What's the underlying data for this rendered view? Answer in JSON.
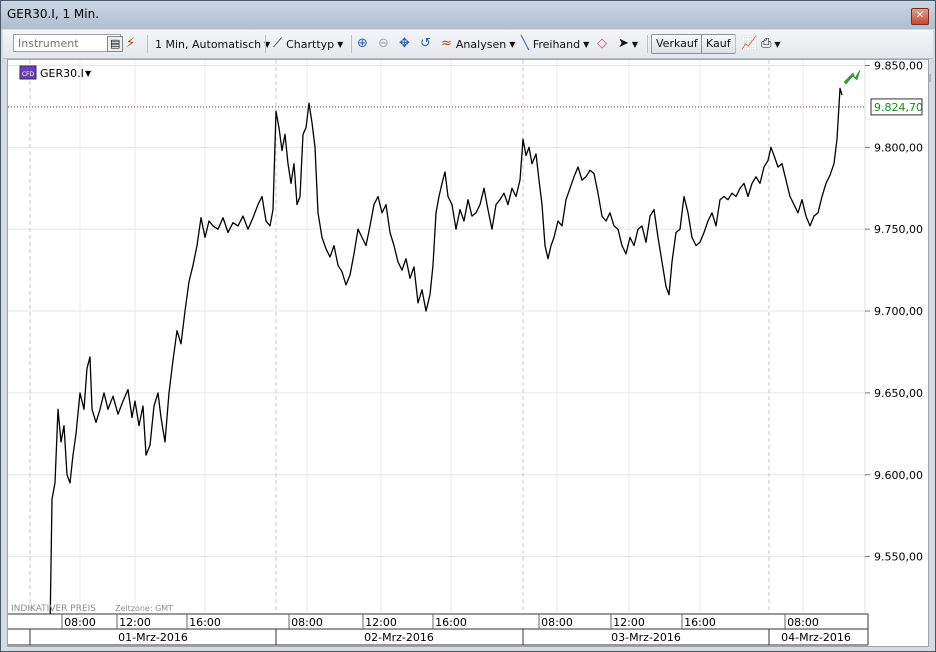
{
  "window": {
    "title": "GER30.I, 1 Min."
  },
  "toolbar": {
    "instrument_placeholder": "Instrument",
    "interval_label": "1 Min,  Automatisch",
    "charttype_label": "Charttyp",
    "analysen_label": "Analysen",
    "freihand_label": "Freihand",
    "verkauf_label": "Verkauf",
    "kauf_label": "Kauf"
  },
  "chart_header": {
    "symbol": "GER30.I",
    "badge": "CFD"
  },
  "footer": {
    "price_type": "INDIKATIVER PREIS",
    "timezone": "Zeitzone: GMT"
  },
  "chart_data": {
    "type": "line",
    "title": "",
    "symbol": "GER30.I",
    "interval": "1 Min.",
    "current_price": 9824.7,
    "current_price_label": "9.824,70",
    "ylim": [
      9505,
      9855
    ],
    "yticks": [
      {
        "value": 9550,
        "label": "9.550,00"
      },
      {
        "value": 9600,
        "label": "9.600,00"
      },
      {
        "value": 9650,
        "label": "9.650,00"
      },
      {
        "value": 9700,
        "label": "9.700,00"
      },
      {
        "value": 9750,
        "label": "9.750,00"
      },
      {
        "value": 9800,
        "label": "9.800,00"
      },
      {
        "value": 9850,
        "label": "9.850,00"
      }
    ],
    "xlim": [
      0,
      834
    ],
    "xticks": [
      {
        "x": 72,
        "label": "08:00"
      },
      {
        "x": 127,
        "label": "12:00"
      },
      {
        "x": 197,
        "label": "16:00"
      },
      {
        "x": 299,
        "label": "08:00"
      },
      {
        "x": 373,
        "label": "12:00"
      },
      {
        "x": 443,
        "label": "16:00"
      },
      {
        "x": 549,
        "label": "08:00"
      },
      {
        "x": 621,
        "label": "12:00"
      },
      {
        "x": 692,
        "label": "16:00"
      },
      {
        "x": 795,
        "label": "08:00"
      }
    ],
    "day_dividers": [
      22,
      268,
      515,
      761
    ],
    "days": [
      {
        "x": 145,
        "label": "01-Mrz-2016"
      },
      {
        "x": 391,
        "label": "02-Mrz-2016"
      },
      {
        "x": 638,
        "label": "03-Mrz-2016"
      },
      {
        "x": 808,
        "label": "04-Mrz-2016"
      }
    ],
    "series": [
      {
        "values": [
          [
            42,
            9505
          ],
          [
            44,
            9585
          ],
          [
            47,
            9595
          ],
          [
            50,
            9640
          ],
          [
            53,
            9620
          ],
          [
            56,
            9630
          ],
          [
            59,
            9600
          ],
          [
            62,
            9595
          ],
          [
            65,
            9612
          ],
          [
            68,
            9625
          ],
          [
            72,
            9650
          ],
          [
            76,
            9640
          ],
          [
            79,
            9665
          ],
          [
            82,
            9672
          ],
          [
            84,
            9640
          ],
          [
            88,
            9632
          ],
          [
            92,
            9640
          ],
          [
            96,
            9650
          ],
          [
            100,
            9640
          ],
          [
            105,
            9648
          ],
          [
            110,
            9637
          ],
          [
            115,
            9645
          ],
          [
            120,
            9652
          ],
          [
            124,
            9635
          ],
          [
            127,
            9645
          ],
          [
            131,
            9630
          ],
          [
            135,
            9642
          ],
          [
            138,
            9612
          ],
          [
            142,
            9618
          ],
          [
            146,
            9642
          ],
          [
            150,
            9650
          ],
          [
            153,
            9635
          ],
          [
            157,
            9620
          ],
          [
            161,
            9650
          ],
          [
            165,
            9670
          ],
          [
            169,
            9688
          ],
          [
            173,
            9680
          ],
          [
            177,
            9700
          ],
          [
            181,
            9718
          ],
          [
            185,
            9728
          ],
          [
            189,
            9740
          ],
          [
            193,
            9757
          ],
          [
            197,
            9745
          ],
          [
            201,
            9755
          ],
          [
            205,
            9752
          ],
          [
            210,
            9750
          ],
          [
            215,
            9757
          ],
          [
            220,
            9748
          ],
          [
            225,
            9754
          ],
          [
            230,
            9752
          ],
          [
            235,
            9758
          ],
          [
            240,
            9750
          ],
          [
            245,
            9757
          ],
          [
            250,
            9765
          ],
          [
            254,
            9770
          ],
          [
            258,
            9755
          ],
          [
            262,
            9752
          ],
          [
            265,
            9762
          ],
          [
            268,
            9822
          ],
          [
            271,
            9812
          ],
          [
            274,
            9798
          ],
          [
            277,
            9808
          ],
          [
            280,
            9790
          ],
          [
            283,
            9778
          ],
          [
            286,
            9790
          ],
          [
            289,
            9765
          ],
          [
            292,
            9770
          ],
          [
            295,
            9808
          ],
          [
            298,
            9812
          ],
          [
            301,
            9827
          ],
          [
            304,
            9815
          ],
          [
            307,
            9800
          ],
          [
            310,
            9760
          ],
          [
            314,
            9745
          ],
          [
            318,
            9738
          ],
          [
            322,
            9733
          ],
          [
            326,
            9740
          ],
          [
            330,
            9728
          ],
          [
            334,
            9724
          ],
          [
            338,
            9716
          ],
          [
            342,
            9722
          ],
          [
            346,
            9735
          ],
          [
            350,
            9750
          ],
          [
            354,
            9745
          ],
          [
            358,
            9740
          ],
          [
            362,
            9752
          ],
          [
            366,
            9765
          ],
          [
            370,
            9770
          ],
          [
            374,
            9760
          ],
          [
            378,
            9765
          ],
          [
            382,
            9748
          ],
          [
            386,
            9740
          ],
          [
            390,
            9730
          ],
          [
            394,
            9725
          ],
          [
            398,
            9732
          ],
          [
            402,
            9720
          ],
          [
            406,
            9727
          ],
          [
            410,
            9705
          ],
          [
            414,
            9713
          ],
          [
            418,
            9700
          ],
          [
            422,
            9710
          ],
          [
            425,
            9728
          ],
          [
            428,
            9760
          ],
          [
            431,
            9770
          ],
          [
            434,
            9778
          ],
          [
            437,
            9785
          ],
          [
            440,
            9770
          ],
          [
            444,
            9765
          ],
          [
            448,
            9750
          ],
          [
            452,
            9762
          ],
          [
            456,
            9755
          ],
          [
            460,
            9768
          ],
          [
            464,
            9758
          ],
          [
            468,
            9760
          ],
          [
            472,
            9765
          ],
          [
            476,
            9775
          ],
          [
            480,
            9762
          ],
          [
            484,
            9750
          ],
          [
            488,
            9765
          ],
          [
            492,
            9768
          ],
          [
            496,
            9772
          ],
          [
            500,
            9765
          ],
          [
            504,
            9775
          ],
          [
            508,
            9770
          ],
          [
            512,
            9780
          ],
          [
            515,
            9805
          ],
          [
            518,
            9795
          ],
          [
            521,
            9800
          ],
          [
            524,
            9790
          ],
          [
            528,
            9796
          ],
          [
            531,
            9780
          ],
          [
            534,
            9765
          ],
          [
            537,
            9740
          ],
          [
            540,
            9732
          ],
          [
            543,
            9740
          ],
          [
            546,
            9745
          ],
          [
            550,
            9755
          ],
          [
            554,
            9752
          ],
          [
            558,
            9768
          ],
          [
            562,
            9775
          ],
          [
            566,
            9782
          ],
          [
            570,
            9788
          ],
          [
            574,
            9780
          ],
          [
            578,
            9782
          ],
          [
            582,
            9786
          ],
          [
            586,
            9784
          ],
          [
            590,
            9772
          ],
          [
            594,
            9758
          ],
          [
            598,
            9755
          ],
          [
            602,
            9760
          ],
          [
            606,
            9752
          ],
          [
            610,
            9750
          ],
          [
            614,
            9740
          ],
          [
            618,
            9735
          ],
          [
            622,
            9745
          ],
          [
            626,
            9740
          ],
          [
            630,
            9750
          ],
          [
            634,
            9752
          ],
          [
            638,
            9742
          ],
          [
            642,
            9758
          ],
          [
            646,
            9762
          ],
          [
            650,
            9745
          ],
          [
            654,
            9730
          ],
          [
            658,
            9715
          ],
          [
            661,
            9710
          ],
          [
            664,
            9730
          ],
          [
            668,
            9748
          ],
          [
            672,
            9750
          ],
          [
            676,
            9770
          ],
          [
            680,
            9760
          ],
          [
            684,
            9745
          ],
          [
            688,
            9740
          ],
          [
            692,
            9742
          ],
          [
            696,
            9748
          ],
          [
            700,
            9755
          ],
          [
            704,
            9760
          ],
          [
            708,
            9752
          ],
          [
            712,
            9768
          ],
          [
            716,
            9770
          ],
          [
            720,
            9768
          ],
          [
            724,
            9772
          ],
          [
            728,
            9770
          ],
          [
            732,
            9775
          ],
          [
            736,
            9778
          ],
          [
            740,
            9770
          ],
          [
            744,
            9778
          ],
          [
            748,
            9782
          ],
          [
            752,
            9778
          ],
          [
            756,
            9788
          ],
          [
            760,
            9792
          ],
          [
            763,
            9800
          ],
          [
            766,
            9795
          ],
          [
            770,
            9788
          ],
          [
            774,
            9790
          ],
          [
            778,
            9780
          ],
          [
            782,
            9770
          ],
          [
            786,
            9765
          ],
          [
            790,
            9760
          ],
          [
            794,
            9768
          ],
          [
            798,
            9758
          ],
          [
            802,
            9752
          ],
          [
            806,
            9758
          ],
          [
            810,
            9760
          ],
          [
            814,
            9770
          ],
          [
            818,
            9778
          ],
          [
            822,
            9783
          ],
          [
            826,
            9790
          ],
          [
            829,
            9805
          ],
          [
            832,
            9836
          ],
          [
            834,
            9832
          ]
        ]
      }
    ]
  }
}
